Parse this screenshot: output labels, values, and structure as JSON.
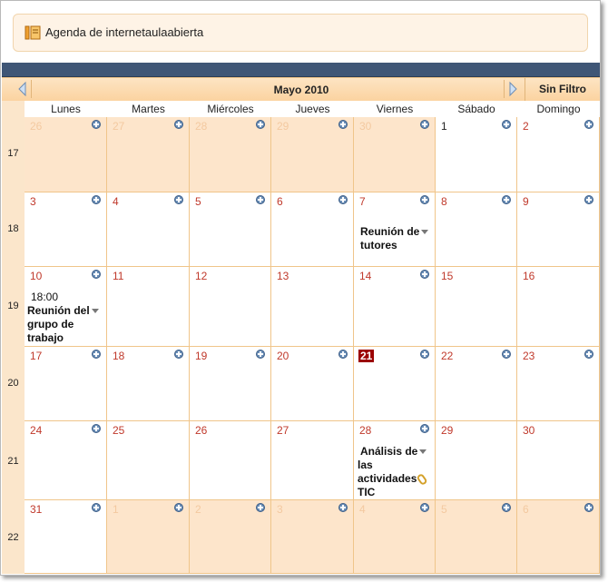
{
  "header": {
    "title": "Agenda de internetaulaabierta"
  },
  "nav": {
    "month": "Mayo 2010",
    "filter": "Sin Filtro"
  },
  "days": [
    "Lunes",
    "Martes",
    "Miércoles",
    "Jueves",
    "Viernes",
    "Sábado",
    "Domingo"
  ],
  "weeks": [
    {
      "num": "17",
      "days": [
        "26",
        "27",
        "28",
        "29",
        "30",
        "1",
        "2"
      ]
    },
    {
      "num": "18",
      "days": [
        "3",
        "4",
        "5",
        "6",
        "7",
        "8",
        "9"
      ]
    },
    {
      "num": "19",
      "days": [
        "10",
        "11",
        "12",
        "13",
        "14",
        "15",
        "16"
      ]
    },
    {
      "num": "20",
      "days": [
        "17",
        "18",
        "19",
        "20",
        "21",
        "22",
        "23"
      ]
    },
    {
      "num": "21",
      "days": [
        "24",
        "25",
        "26",
        "27",
        "28",
        "29",
        "30"
      ]
    },
    {
      "num": "22",
      "days": [
        "31",
        "1",
        "2",
        "3",
        "4",
        "5",
        "6"
      ]
    }
  ],
  "events": {
    "e1": {
      "title_l1": "Reunión de",
      "title_l2": "tutores"
    },
    "e2": {
      "time": "18:00",
      "title_l1": "Reunión del",
      "title_l2": "grupo de",
      "title_l3": "trabajo"
    },
    "e3": {
      "title_l1": "Análisis de",
      "title_l2": "las",
      "title_l3": "actividades",
      "title_l4": "TIC"
    }
  },
  "colors": {
    "accent": "#3f5676",
    "today": "#9b0000",
    "daynum": "#c0392b",
    "other_bg": "#fde5cb"
  }
}
